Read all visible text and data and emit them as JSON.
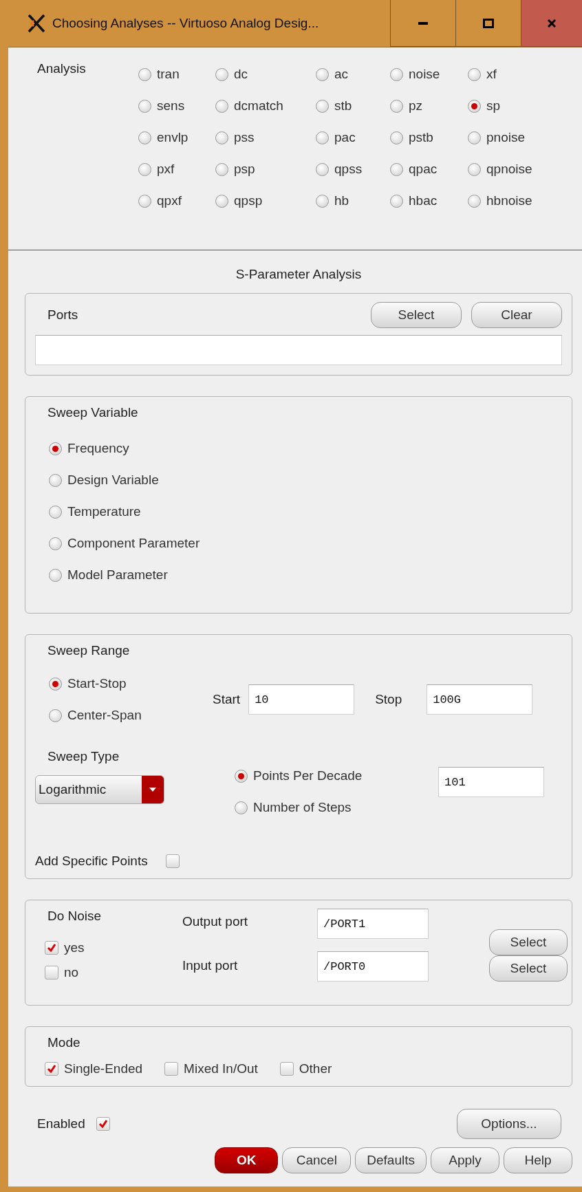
{
  "window": {
    "title": "Choosing Analyses -- Virtuoso Analog Desig..."
  },
  "analysis": {
    "label": "Analysis",
    "options": [
      {
        "label": "tran",
        "selected": false
      },
      {
        "label": "dc",
        "selected": false
      },
      {
        "label": "ac",
        "selected": false
      },
      {
        "label": "noise",
        "selected": false
      },
      {
        "label": "xf",
        "selected": false
      },
      {
        "label": "sens",
        "selected": false
      },
      {
        "label": "dcmatch",
        "selected": false
      },
      {
        "label": "stb",
        "selected": false
      },
      {
        "label": "pz",
        "selected": false
      },
      {
        "label": "sp",
        "selected": true
      },
      {
        "label": "envlp",
        "selected": false
      },
      {
        "label": "pss",
        "selected": false
      },
      {
        "label": "pac",
        "selected": false
      },
      {
        "label": "pstb",
        "selected": false
      },
      {
        "label": "pnoise",
        "selected": false
      },
      {
        "label": "pxf",
        "selected": false
      },
      {
        "label": "psp",
        "selected": false
      },
      {
        "label": "qpss",
        "selected": false
      },
      {
        "label": "qpac",
        "selected": false
      },
      {
        "label": "qpnoise",
        "selected": false
      },
      {
        "label": "qpxf",
        "selected": false
      },
      {
        "label": "qpsp",
        "selected": false
      },
      {
        "label": "hb",
        "selected": false
      },
      {
        "label": "hbac",
        "selected": false
      },
      {
        "label": "hbnoise",
        "selected": false
      }
    ]
  },
  "section_title": "S-Parameter Analysis",
  "ports": {
    "label": "Ports",
    "buttons": [
      "Select",
      "Clear"
    ]
  },
  "sweep_variable": {
    "title": "Sweep Variable",
    "options": [
      {
        "label": "Frequency",
        "selected": true
      },
      {
        "label": "Design Variable",
        "selected": false
      },
      {
        "label": "Temperature",
        "selected": false
      },
      {
        "label": "Component Parameter",
        "selected": false
      },
      {
        "label": "Model Parameter",
        "selected": false
      }
    ]
  },
  "sweep_range": {
    "title": "Sweep Range",
    "options": [
      {
        "label": "Start-Stop",
        "selected": true
      },
      {
        "label": "Center-Span",
        "selected": false
      }
    ],
    "start": {
      "label": "Start",
      "value": "10"
    },
    "stop": {
      "label": "Stop",
      "value": "100G"
    },
    "sweep_type": {
      "label": "Sweep Type",
      "value": "Logarithmic"
    },
    "step_options": [
      {
        "label": "Points Per Decade",
        "selected": true
      },
      {
        "label": "Number of Steps",
        "selected": false
      }
    ],
    "step_value": "101",
    "specific_points": {
      "label": "Add Specific Points",
      "checked": false
    }
  },
  "do_noise": {
    "title": "Do Noise",
    "options": [
      {
        "label": "yes",
        "checked": true
      },
      {
        "label": "no",
        "checked": false
      }
    ],
    "ports": [
      {
        "label": "Output port",
        "value": "/PORT1",
        "button": "Select"
      },
      {
        "label": "Input port",
        "value": "/PORT0",
        "button": "Select"
      }
    ]
  },
  "mode": {
    "title": "Mode",
    "options": [
      {
        "label": "Single-Ended",
        "checked": true
      },
      {
        "label": "Mixed In/Out",
        "checked": false
      },
      {
        "label": "Other",
        "checked": false
      }
    ]
  },
  "enabled": {
    "label": "Enabled",
    "checked": true
  },
  "options_button": "Options...",
  "footer_buttons": [
    {
      "label": "OK",
      "kind": "primary"
    },
    {
      "label": "Cancel",
      "kind": "normal"
    },
    {
      "label": "Defaults",
      "kind": "normal"
    },
    {
      "label": "Apply",
      "kind": "normal"
    },
    {
      "label": "Help",
      "kind": "normal"
    }
  ]
}
